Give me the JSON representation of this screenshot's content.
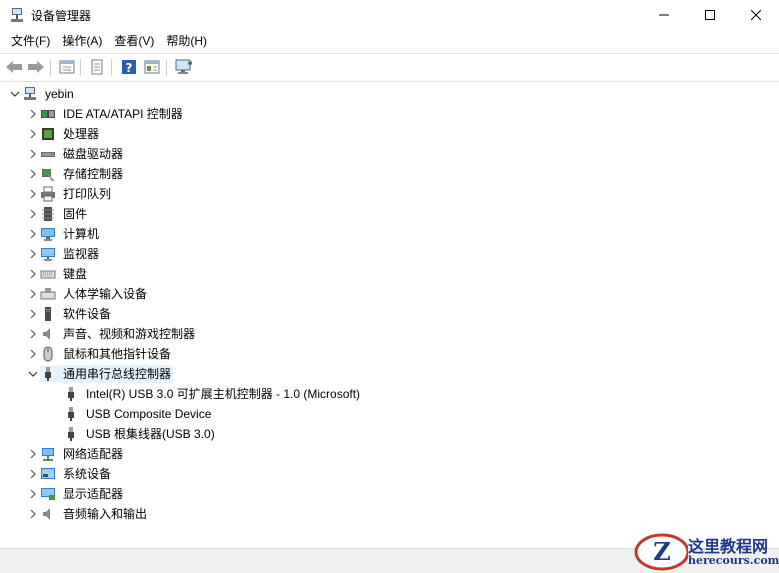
{
  "window": {
    "title": "设备管理器"
  },
  "menu": [
    "文件(F)",
    "操作(A)",
    "查看(V)",
    "帮助(H)"
  ],
  "toolbar": [
    "back-icon",
    "forward-icon",
    "properties-view-icon",
    "document-icon",
    "help-icon",
    "panel-view-icon",
    "monitor-scan-icon"
  ],
  "tree": {
    "root": "yebin",
    "categories": [
      {
        "label": "IDE ATA/ATAPI 控制器",
        "icon": "ide-controller-icon"
      },
      {
        "label": "处理器",
        "icon": "processor-icon"
      },
      {
        "label": "磁盘驱动器",
        "icon": "disk-drive-icon"
      },
      {
        "label": "存储控制器",
        "icon": "storage-controller-icon"
      },
      {
        "label": "打印队列",
        "icon": "printer-icon"
      },
      {
        "label": "固件",
        "icon": "firmware-icon"
      },
      {
        "label": "计算机",
        "icon": "computer-icon"
      },
      {
        "label": "监视器",
        "icon": "monitor-icon"
      },
      {
        "label": "键盘",
        "icon": "keyboard-icon"
      },
      {
        "label": "人体学输入设备",
        "icon": "hid-icon"
      },
      {
        "label": "软件设备",
        "icon": "software-device-icon"
      },
      {
        "label": "声音、视频和游戏控制器",
        "icon": "speaker-icon"
      },
      {
        "label": "鼠标和其他指针设备",
        "icon": "mouse-icon"
      },
      {
        "label": "通用串行总线控制器",
        "icon": "usb-icon",
        "expanded": true,
        "selected": true,
        "children": [
          {
            "label": "Intel(R) USB 3.0 可扩展主机控制器 - 1.0 (Microsoft)",
            "icon": "usb-icon"
          },
          {
            "label": "USB Composite Device",
            "icon": "usb-icon"
          },
          {
            "label": "USB 根集线器(USB 3.0)",
            "icon": "usb-icon"
          }
        ]
      },
      {
        "label": "网络适配器",
        "icon": "network-adapter-icon"
      },
      {
        "label": "系统设备",
        "icon": "system-device-icon"
      },
      {
        "label": "显示适配器",
        "icon": "display-adapter-icon"
      },
      {
        "label": "音频输入和输出",
        "icon": "audio-io-icon"
      }
    ]
  },
  "watermark": {
    "title": "这里教程网",
    "url": "herecours.com"
  }
}
